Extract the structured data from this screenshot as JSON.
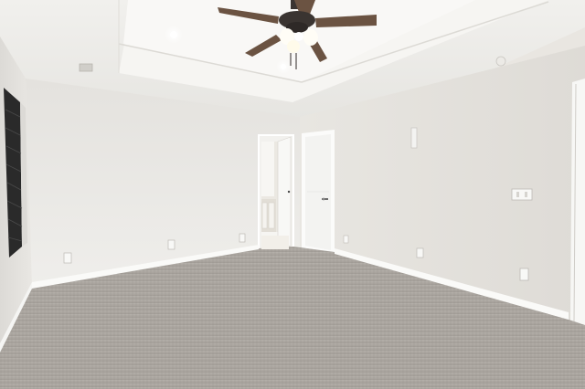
{
  "scene": {
    "subject": "empty-bedroom-interior",
    "colors": {
      "wall_left": "#e8e6e2",
      "wall_back": "#ecebe8",
      "wall_right": "#e6e4df",
      "ceiling": "#f3f2ef",
      "tray_ceiling": "#f8f7f5",
      "carpet": "#a9a49e",
      "baseboard": "#f7f7f5",
      "door": "#f4f4f2",
      "fan_blade": "#6b5342",
      "fan_body": "#3a3431",
      "window_blind": "#2b2b2b"
    }
  }
}
